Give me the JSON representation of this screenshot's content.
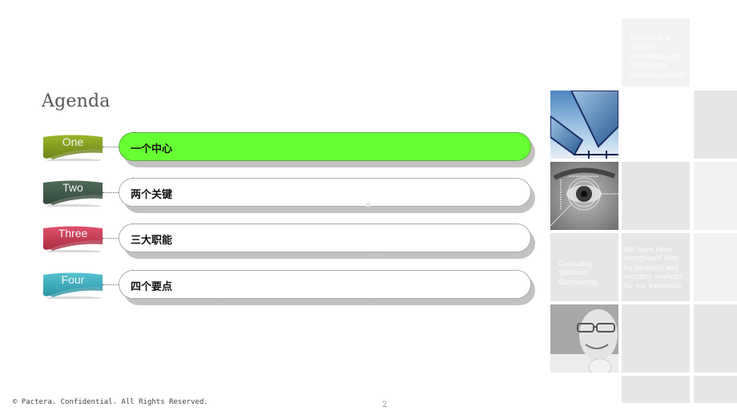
{
  "title": "Agenda",
  "agenda": [
    {
      "ribbon": "One",
      "label": "一个中心",
      "ribbon_color": "#9ab52a",
      "ribbon_dark": "#6e8419",
      "active": true
    },
    {
      "ribbon": "Two",
      "label": "两个关键",
      "ribbon_color": "#4f6b5a",
      "ribbon_dark": "#34483b",
      "active": false
    },
    {
      "ribbon": "Three",
      "label": "三大职能",
      "ribbon_color": "#e0506a",
      "ribbon_dark": "#a82e44",
      "active": false
    },
    {
      "ribbon": "Four",
      "label": "四个要点",
      "ribbon_color": "#55c4d2",
      "ribbon_dark": "#2e94a4",
      "active": false
    }
  ],
  "colors": {
    "active_pill": "#66ff33"
  },
  "tiles": {
    "trusted_text": "Pactera is a trusted consulting and technology services partner",
    "services_text": "Consulting Solutions Outsourcing",
    "recognized_text": "We have been recognized both by partners and industry analysts for our extensive",
    "images": [
      "solar-panels-photo",
      "eye-scan-photo",
      "smiling-man-photo"
    ]
  },
  "footer": {
    "copyright": "© Pactera. Confidential. All Rights Reserved.",
    "page_number": "2"
  }
}
